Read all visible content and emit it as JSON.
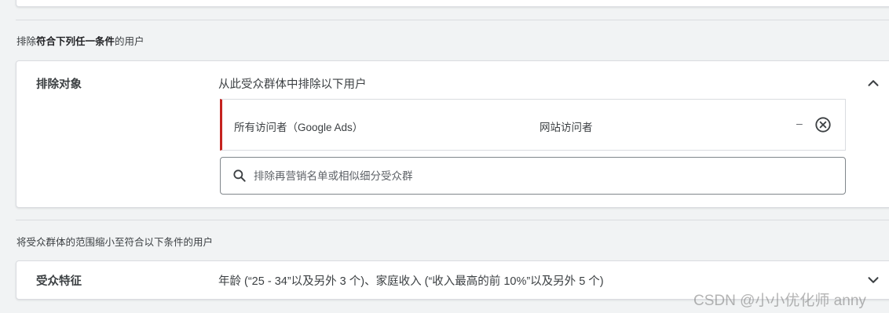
{
  "exclude_section": {
    "heading_prefix": "排除",
    "heading_bold": "符合下列任一条件",
    "heading_suffix": "的用户",
    "card": {
      "label": "排除对象",
      "title": "从此受众群体中排除以下用户",
      "items": [
        {
          "name": "所有访问者（Google Ads）",
          "type": "网站访问者",
          "size": "–"
        }
      ],
      "search": {
        "placeholder": "排除再营销名单或相似细分受众群",
        "value": ""
      },
      "expanded": true,
      "accent_color": "#c5221f"
    }
  },
  "narrow_section": {
    "heading": "将受众群体的范围缩小至符合以下条件的用户",
    "card": {
      "label": "受众特征",
      "summary": "年龄 (“25 - 34”以及另外 3 个)、家庭收入 (“收入最高的前 10%”以及另外 5 个)",
      "expanded": false
    }
  },
  "watermark": "CSDN @小小优化师 anny",
  "icons": {
    "collapse": "chevron-up-icon",
    "expand": "chevron-down-icon",
    "remove": "close-circle-icon",
    "search": "search-icon"
  }
}
